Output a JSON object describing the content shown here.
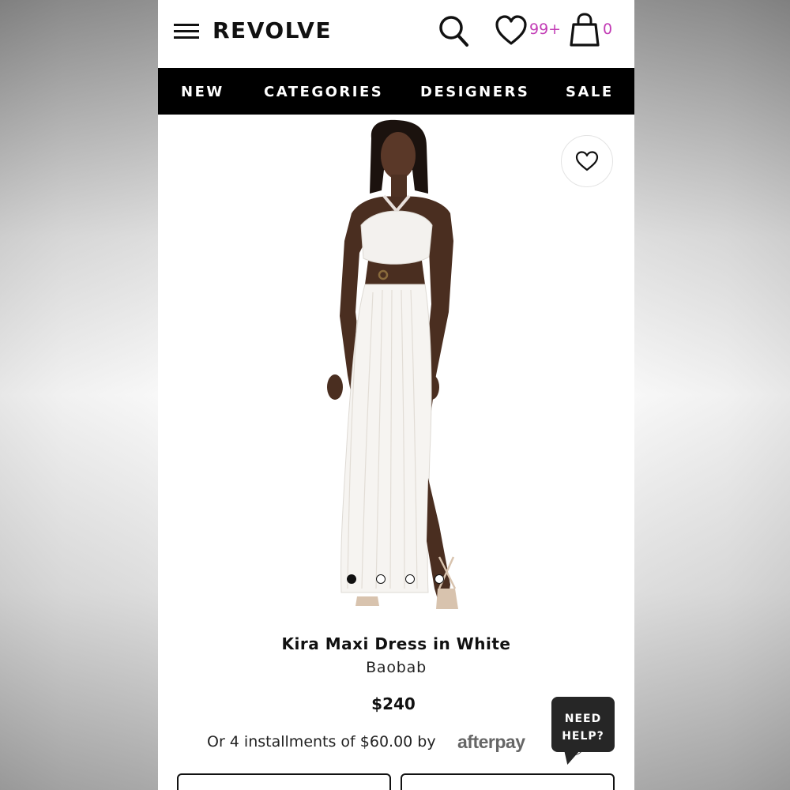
{
  "header": {
    "logo": "REVOLVE",
    "wishlist_count": "99+",
    "bag_count": "0"
  },
  "nav": {
    "items": [
      "NEW",
      "CATEGORIES",
      "DESIGNERS",
      "SALE"
    ]
  },
  "gallery": {
    "image_count": 4,
    "active_index": 0
  },
  "product": {
    "title": "Kira Maxi Dress in White",
    "brand": "Baobab",
    "price": "$240",
    "installments_text": "Or 4 installments of $60.00 by",
    "afterpay_label": "afterpay",
    "info_glyph": "?"
  },
  "help": {
    "line1": "NEED",
    "line2": "HELP?"
  },
  "colors": {
    "accent": "#c23bb5",
    "nav_bg": "#000000",
    "text": "#111111"
  },
  "icons": [
    "menu-icon",
    "search-icon",
    "heart-icon",
    "bag-icon",
    "info-icon"
  ]
}
